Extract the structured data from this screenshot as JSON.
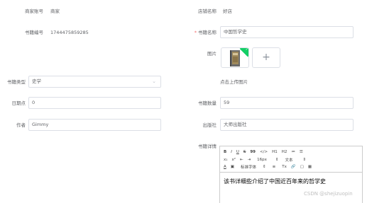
{
  "form": {
    "merchant_account": {
      "label": "商家账号",
      "value": "商家"
    },
    "shop_name": {
      "label": "店铺名称",
      "value": "好店"
    },
    "book_number": {
      "label": "书籍编号",
      "value": "1744475859285"
    },
    "book_name": {
      "label": "书籍名称",
      "required_mark": "*",
      "value": "中国哲学史"
    },
    "image": {
      "label": "图片",
      "upload_plus": "+",
      "hint": "点击上传图片"
    },
    "book_category": {
      "label": "书籍类型",
      "value": "史学"
    },
    "click_count": {
      "label": "日期点",
      "value": "0"
    },
    "book_quantity": {
      "label": "书籍数量",
      "value": "59"
    },
    "author": {
      "label": "作者",
      "value": "Gimmy"
    },
    "publisher": {
      "label": "出版社",
      "value": "大师出版社"
    },
    "book_details": {
      "label": "书籍详情",
      "toolbar_row1": [
        "B",
        "I",
        "U",
        "S",
        "99",
        "</>",
        "H1",
        "H2",
        "≔",
        "☰"
      ],
      "toolbar_row2": [
        "x₁",
        "x²",
        "⇤",
        "⇥",
        "16px",
        "⇕",
        "文本",
        "⇕"
      ],
      "toolbar_row3": [
        "A",
        "▣",
        "标准字体",
        "⇕",
        "≡",
        "Tx",
        "🔗",
        "▢",
        "▦"
      ],
      "content": "该书详细些介绍了中国近百年来的哲学史"
    }
  },
  "watermark": "CSDN @shejizuopin"
}
